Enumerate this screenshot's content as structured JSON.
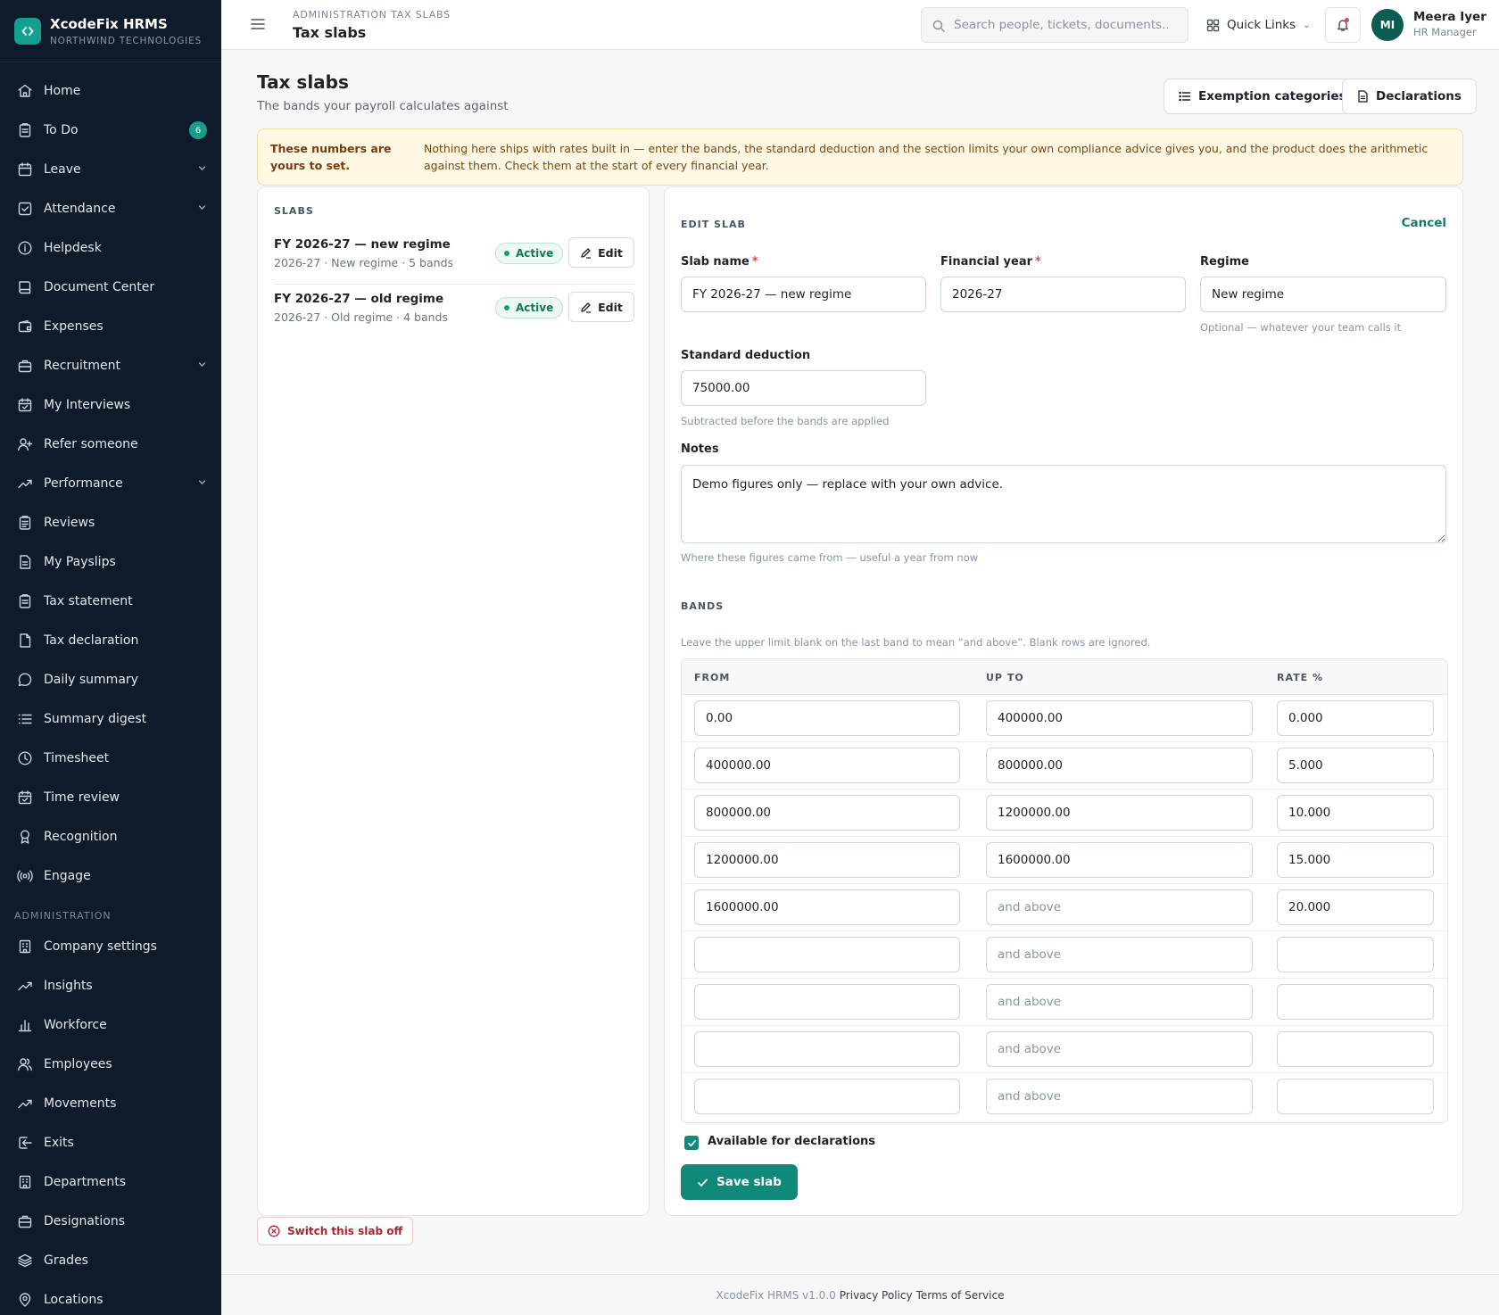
{
  "brand": {
    "name": "XcodeFix HRMS",
    "company": "NORTHWIND TECHNOLOGIES"
  },
  "sidebar": {
    "items": [
      {
        "label": "Home",
        "icon": "home-icon"
      },
      {
        "label": "To Do",
        "icon": "clipboard-icon",
        "badge": "6"
      },
      {
        "label": "Leave",
        "icon": "calendar-icon",
        "expandable": true
      },
      {
        "label": "Attendance",
        "icon": "check-square-icon",
        "expandable": true
      },
      {
        "label": "Helpdesk",
        "icon": "info-icon"
      },
      {
        "label": "Document Center",
        "icon": "book-icon"
      },
      {
        "label": "Expenses",
        "icon": "wallet-icon"
      },
      {
        "label": "Recruitment",
        "icon": "briefcase-icon",
        "expandable": true
      },
      {
        "label": "My Interviews",
        "icon": "calendar-check-icon"
      },
      {
        "label": "Refer someone",
        "icon": "user-plus-icon"
      },
      {
        "label": "Performance",
        "icon": "trending-up-icon",
        "expandable": true
      },
      {
        "label": "Reviews",
        "icon": "clipboard-list-icon"
      },
      {
        "label": "My Payslips",
        "icon": "file-text-icon"
      },
      {
        "label": "Tax statement",
        "icon": "clipboard-icon"
      },
      {
        "label": "Tax declaration",
        "icon": "file-icon"
      },
      {
        "label": "Daily summary",
        "icon": "message-circle-icon"
      },
      {
        "label": "Summary digest",
        "icon": "list-icon"
      },
      {
        "label": "Timesheet",
        "icon": "clock-icon"
      },
      {
        "label": "Time review",
        "icon": "calendar-check-icon"
      },
      {
        "label": "Recognition",
        "icon": "award-icon"
      },
      {
        "label": "Engage",
        "icon": "radio-icon"
      }
    ],
    "admin_section": "ADMINISTRATION",
    "admin_items": [
      {
        "label": "Company settings",
        "icon": "building-icon"
      },
      {
        "label": "Insights",
        "icon": "trending-up-icon"
      },
      {
        "label": "Workforce",
        "icon": "bar-chart-icon"
      },
      {
        "label": "Employees",
        "icon": "users-icon"
      },
      {
        "label": "Movements",
        "icon": "trending-up-icon"
      },
      {
        "label": "Exits",
        "icon": "log-out-icon"
      },
      {
        "label": "Departments",
        "icon": "building-icon"
      },
      {
        "label": "Designations",
        "icon": "briefcase-icon"
      },
      {
        "label": "Grades",
        "icon": "layers-icon"
      },
      {
        "label": "Locations",
        "icon": "map-pin-icon"
      }
    ]
  },
  "header": {
    "breadcrumb": "ADMINISTRATION TAX SLABS",
    "title": "Tax slabs",
    "search_placeholder": "Search people, tickets, documents...",
    "quick_links": "Quick Links",
    "user": {
      "initials": "MI",
      "name": "Meera Iyer",
      "role": "HR Manager"
    }
  },
  "page": {
    "title": "Tax slabs",
    "subtitle": "The bands your payroll calculates against",
    "actions": {
      "exemption": "Exemption categories",
      "declarations": "Declarations"
    },
    "notice": {
      "title": "These numbers are yours to set.",
      "body": "Nothing here ships with rates built in — enter the bands, the standard deduction and the section limits your own compliance advice gives you, and the product does the arithmetic against them. Check them at the start of every financial year."
    }
  },
  "slabs": {
    "section": "SLABS",
    "items": [
      {
        "name": "FY 2026-27 — new regime",
        "meta": "2026-27 · New regime · 5 bands",
        "status": "Active",
        "edit": "Edit"
      },
      {
        "name": "FY 2026-27 — old regime",
        "meta": "2026-27 · Old regime · 4 bands",
        "status": "Active",
        "edit": "Edit"
      }
    ],
    "switch_off": "Switch this slab off"
  },
  "edit": {
    "section": "EDIT SLAB",
    "cancel": "Cancel",
    "slab_name": {
      "label": "Slab name",
      "value": "FY 2026-27 — new regime"
    },
    "financial_year": {
      "label": "Financial year",
      "value": "2026-27"
    },
    "regime": {
      "label": "Regime",
      "value": "New regime",
      "hint": "Optional — whatever your team calls it"
    },
    "standard_deduction": {
      "label": "Standard deduction",
      "value": "75000.00",
      "hint": "Subtracted before the bands are applied"
    },
    "notes": {
      "label": "Notes",
      "value": "Demo figures only — replace with your own advice.",
      "hint": "Where these figures came from — useful a year from now"
    },
    "bands_section": "BANDS",
    "bands_hint": "Leave the upper limit blank on the last band to mean “and above”. Blank rows are ignored.",
    "columns": {
      "from": "FROM",
      "to": "UP TO",
      "rate": "RATE %"
    },
    "to_placeholder": "and above",
    "bands": [
      {
        "from": "0.00",
        "to": "400000.00",
        "rate": "0.000"
      },
      {
        "from": "400000.00",
        "to": "800000.00",
        "rate": "5.000"
      },
      {
        "from": "800000.00",
        "to": "1200000.00",
        "rate": "10.000"
      },
      {
        "from": "1200000.00",
        "to": "1600000.00",
        "rate": "15.000"
      },
      {
        "from": "1600000.00",
        "to": "",
        "rate": "20.000"
      },
      {
        "from": "",
        "to": "",
        "rate": ""
      },
      {
        "from": "",
        "to": "",
        "rate": ""
      },
      {
        "from": "",
        "to": "",
        "rate": ""
      },
      {
        "from": "",
        "to": "",
        "rate": ""
      }
    ],
    "available_label": "Available for declarations",
    "available_checked": true,
    "save": "Save slab"
  },
  "footer": {
    "version": "XcodeFix HRMS v1.0.0",
    "privacy": "Privacy Policy",
    "terms": "Terms of Service"
  },
  "colors": {
    "accent": "#0f8a7a",
    "sidebar": "#0f1a2a",
    "notice_bg": "#fdf7e3",
    "danger": "#b4232c"
  }
}
